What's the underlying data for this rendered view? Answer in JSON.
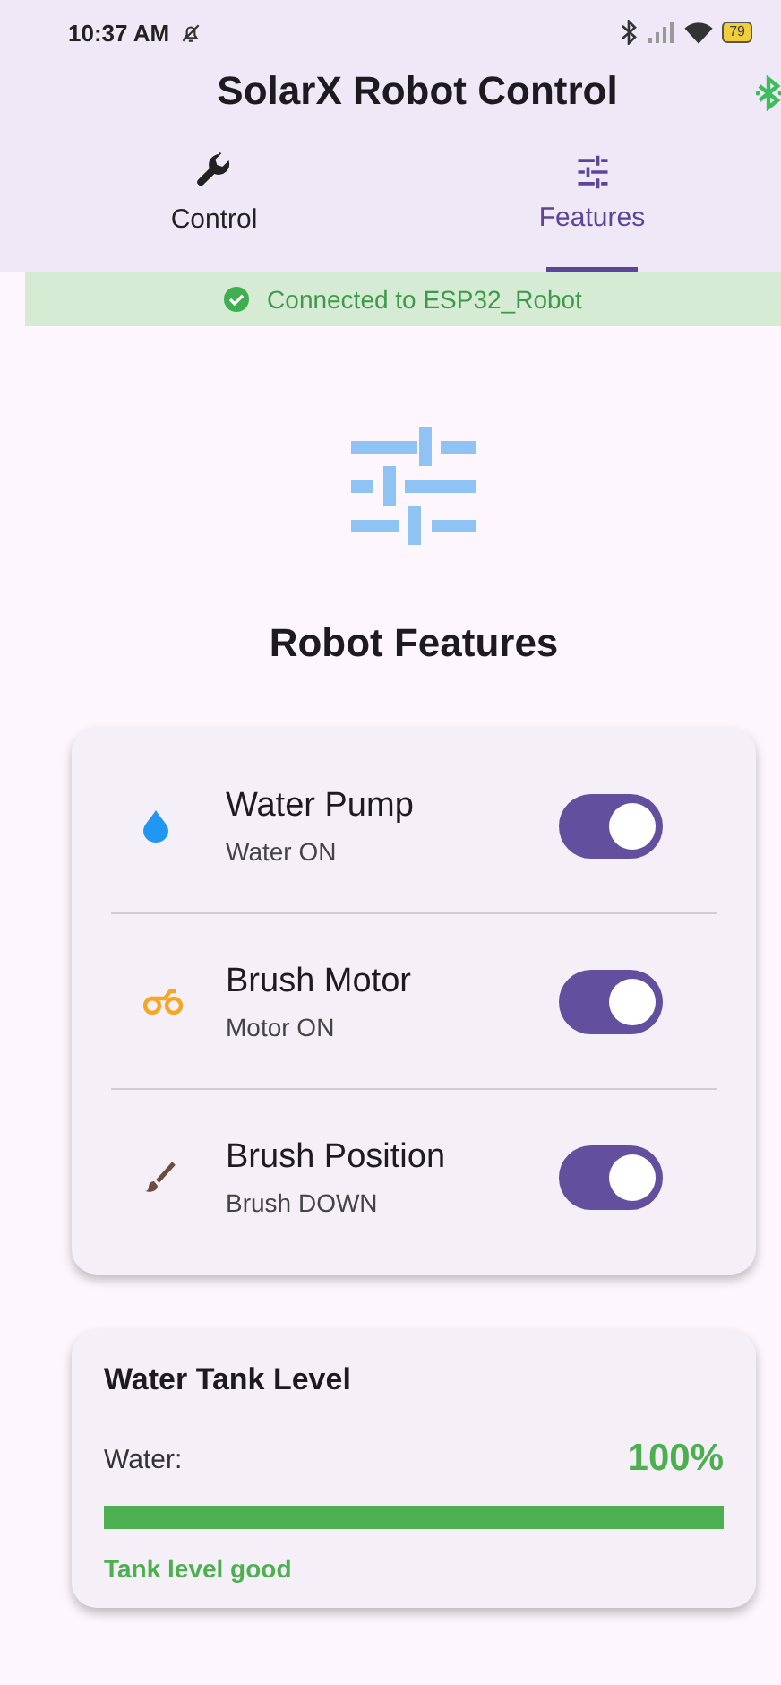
{
  "status_bar": {
    "time": "10:37 AM",
    "battery": "79"
  },
  "app_bar": {
    "title": "SolarX Robot Control"
  },
  "tabs": [
    {
      "label": "Control",
      "selected": false
    },
    {
      "label": "Features",
      "selected": true
    }
  ],
  "connection": {
    "text": "Connected to ESP32_Robot",
    "connected": true
  },
  "page": {
    "heading": "Robot Features"
  },
  "features": [
    {
      "kind": "water",
      "name": "Water Pump",
      "status": "Water ON",
      "on": true
    },
    {
      "kind": "motor",
      "name": "Brush Motor",
      "status": "Motor ON",
      "on": true
    },
    {
      "kind": "brush",
      "name": "Brush Position",
      "status": "Brush DOWN",
      "on": true
    }
  ],
  "tank": {
    "title": "Water Tank Level",
    "label": "Water:",
    "reading": "100%",
    "level": 1,
    "note": "Tank level good"
  }
}
